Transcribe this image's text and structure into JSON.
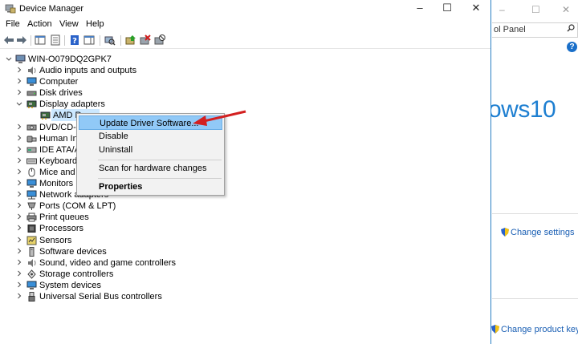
{
  "window": {
    "title": "Device Manager",
    "minimize": "–",
    "maximize": "☐",
    "close": "✕"
  },
  "menu": [
    "File",
    "Action",
    "View",
    "Help"
  ],
  "tree": {
    "root": "WIN-O079DQ2GPK7",
    "items": [
      {
        "label": "Audio inputs and outputs",
        "icon": "speaker-icon",
        "expanded": false
      },
      {
        "label": "Computer",
        "icon": "monitor-icon",
        "expanded": false
      },
      {
        "label": "Disk drives",
        "icon": "disk-icon",
        "expanded": false
      },
      {
        "label": "Display adapters",
        "icon": "display-adapter-icon",
        "expanded": true
      },
      {
        "label": "AMD R",
        "icon": "display-adapter-icon",
        "child": true,
        "selected": true
      },
      {
        "label": "DVD/CD-R",
        "icon": "dvd-icon",
        "expanded": false
      },
      {
        "label": "Human Int",
        "icon": "hid-icon",
        "expanded": false
      },
      {
        "label": "IDE ATA/AT",
        "icon": "ide-icon",
        "expanded": false
      },
      {
        "label": "Keyboards",
        "icon": "keyboard-icon",
        "expanded": false
      },
      {
        "label": "Mice and c",
        "icon": "mouse-icon",
        "expanded": false
      },
      {
        "label": "Monitors",
        "icon": "monitor-icon",
        "expanded": false
      },
      {
        "label": "Network adapters",
        "icon": "network-icon",
        "expanded": false
      },
      {
        "label": "Ports (COM & LPT)",
        "icon": "port-icon",
        "expanded": false
      },
      {
        "label": "Print queues",
        "icon": "printer-icon",
        "expanded": false
      },
      {
        "label": "Processors",
        "icon": "processor-icon",
        "expanded": false
      },
      {
        "label": "Sensors",
        "icon": "sensor-icon",
        "expanded": false
      },
      {
        "label": "Software devices",
        "icon": "software-device-icon",
        "expanded": false
      },
      {
        "label": "Sound, video and game controllers",
        "icon": "speaker-icon",
        "expanded": false
      },
      {
        "label": "Storage controllers",
        "icon": "storage-icon",
        "expanded": false
      },
      {
        "label": "System devices",
        "icon": "monitor-icon",
        "expanded": false
      },
      {
        "label": "Universal Serial Bus controllers",
        "icon": "usb-icon",
        "expanded": false
      }
    ]
  },
  "context_menu": {
    "update": "Update Driver Software...",
    "disable": "Disable",
    "uninstall": "Uninstall",
    "scan": "Scan for hardware changes",
    "properties": "Properties"
  },
  "background_window": {
    "search_text": "ol Panel",
    "help": "?",
    "logo_text": "ows10",
    "change_settings": "Change settings",
    "change_product_key": "Change product key"
  },
  "colors": {
    "accent": "#1e7fd1",
    "menu_highlight": "#91c9f7",
    "arrow": "#d32020"
  }
}
